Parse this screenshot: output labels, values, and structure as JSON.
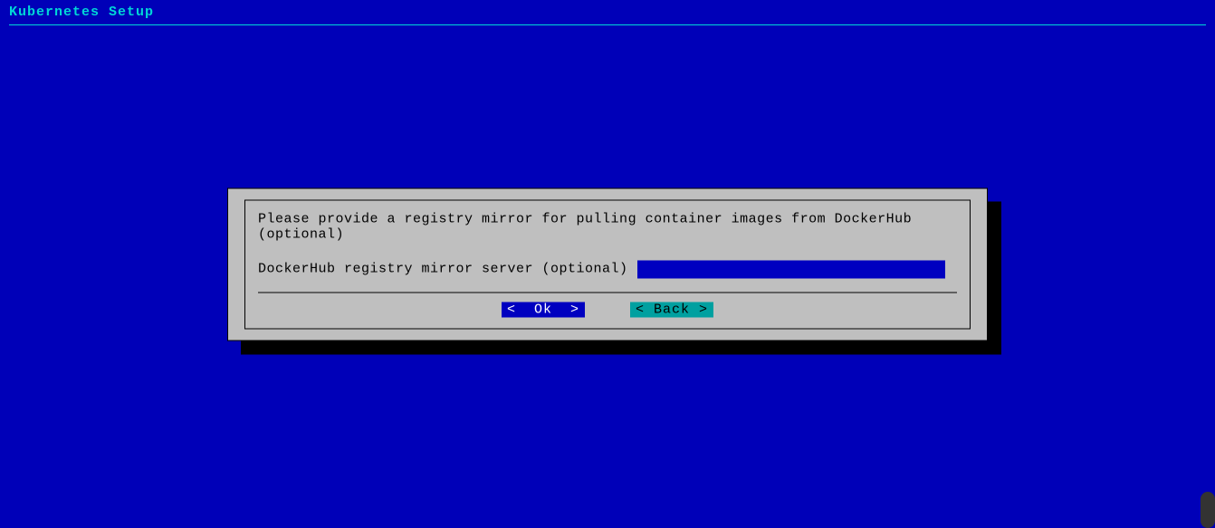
{
  "header": {
    "title": "Kubernetes Setup"
  },
  "dialog": {
    "message": "Please provide a registry mirror for pulling container images from DockerHub (optional)",
    "input_label": "DockerHub registry mirror server (optional)",
    "input_value": "",
    "buttons": {
      "ok": "<  Ok  >",
      "back": "< Back >"
    }
  }
}
